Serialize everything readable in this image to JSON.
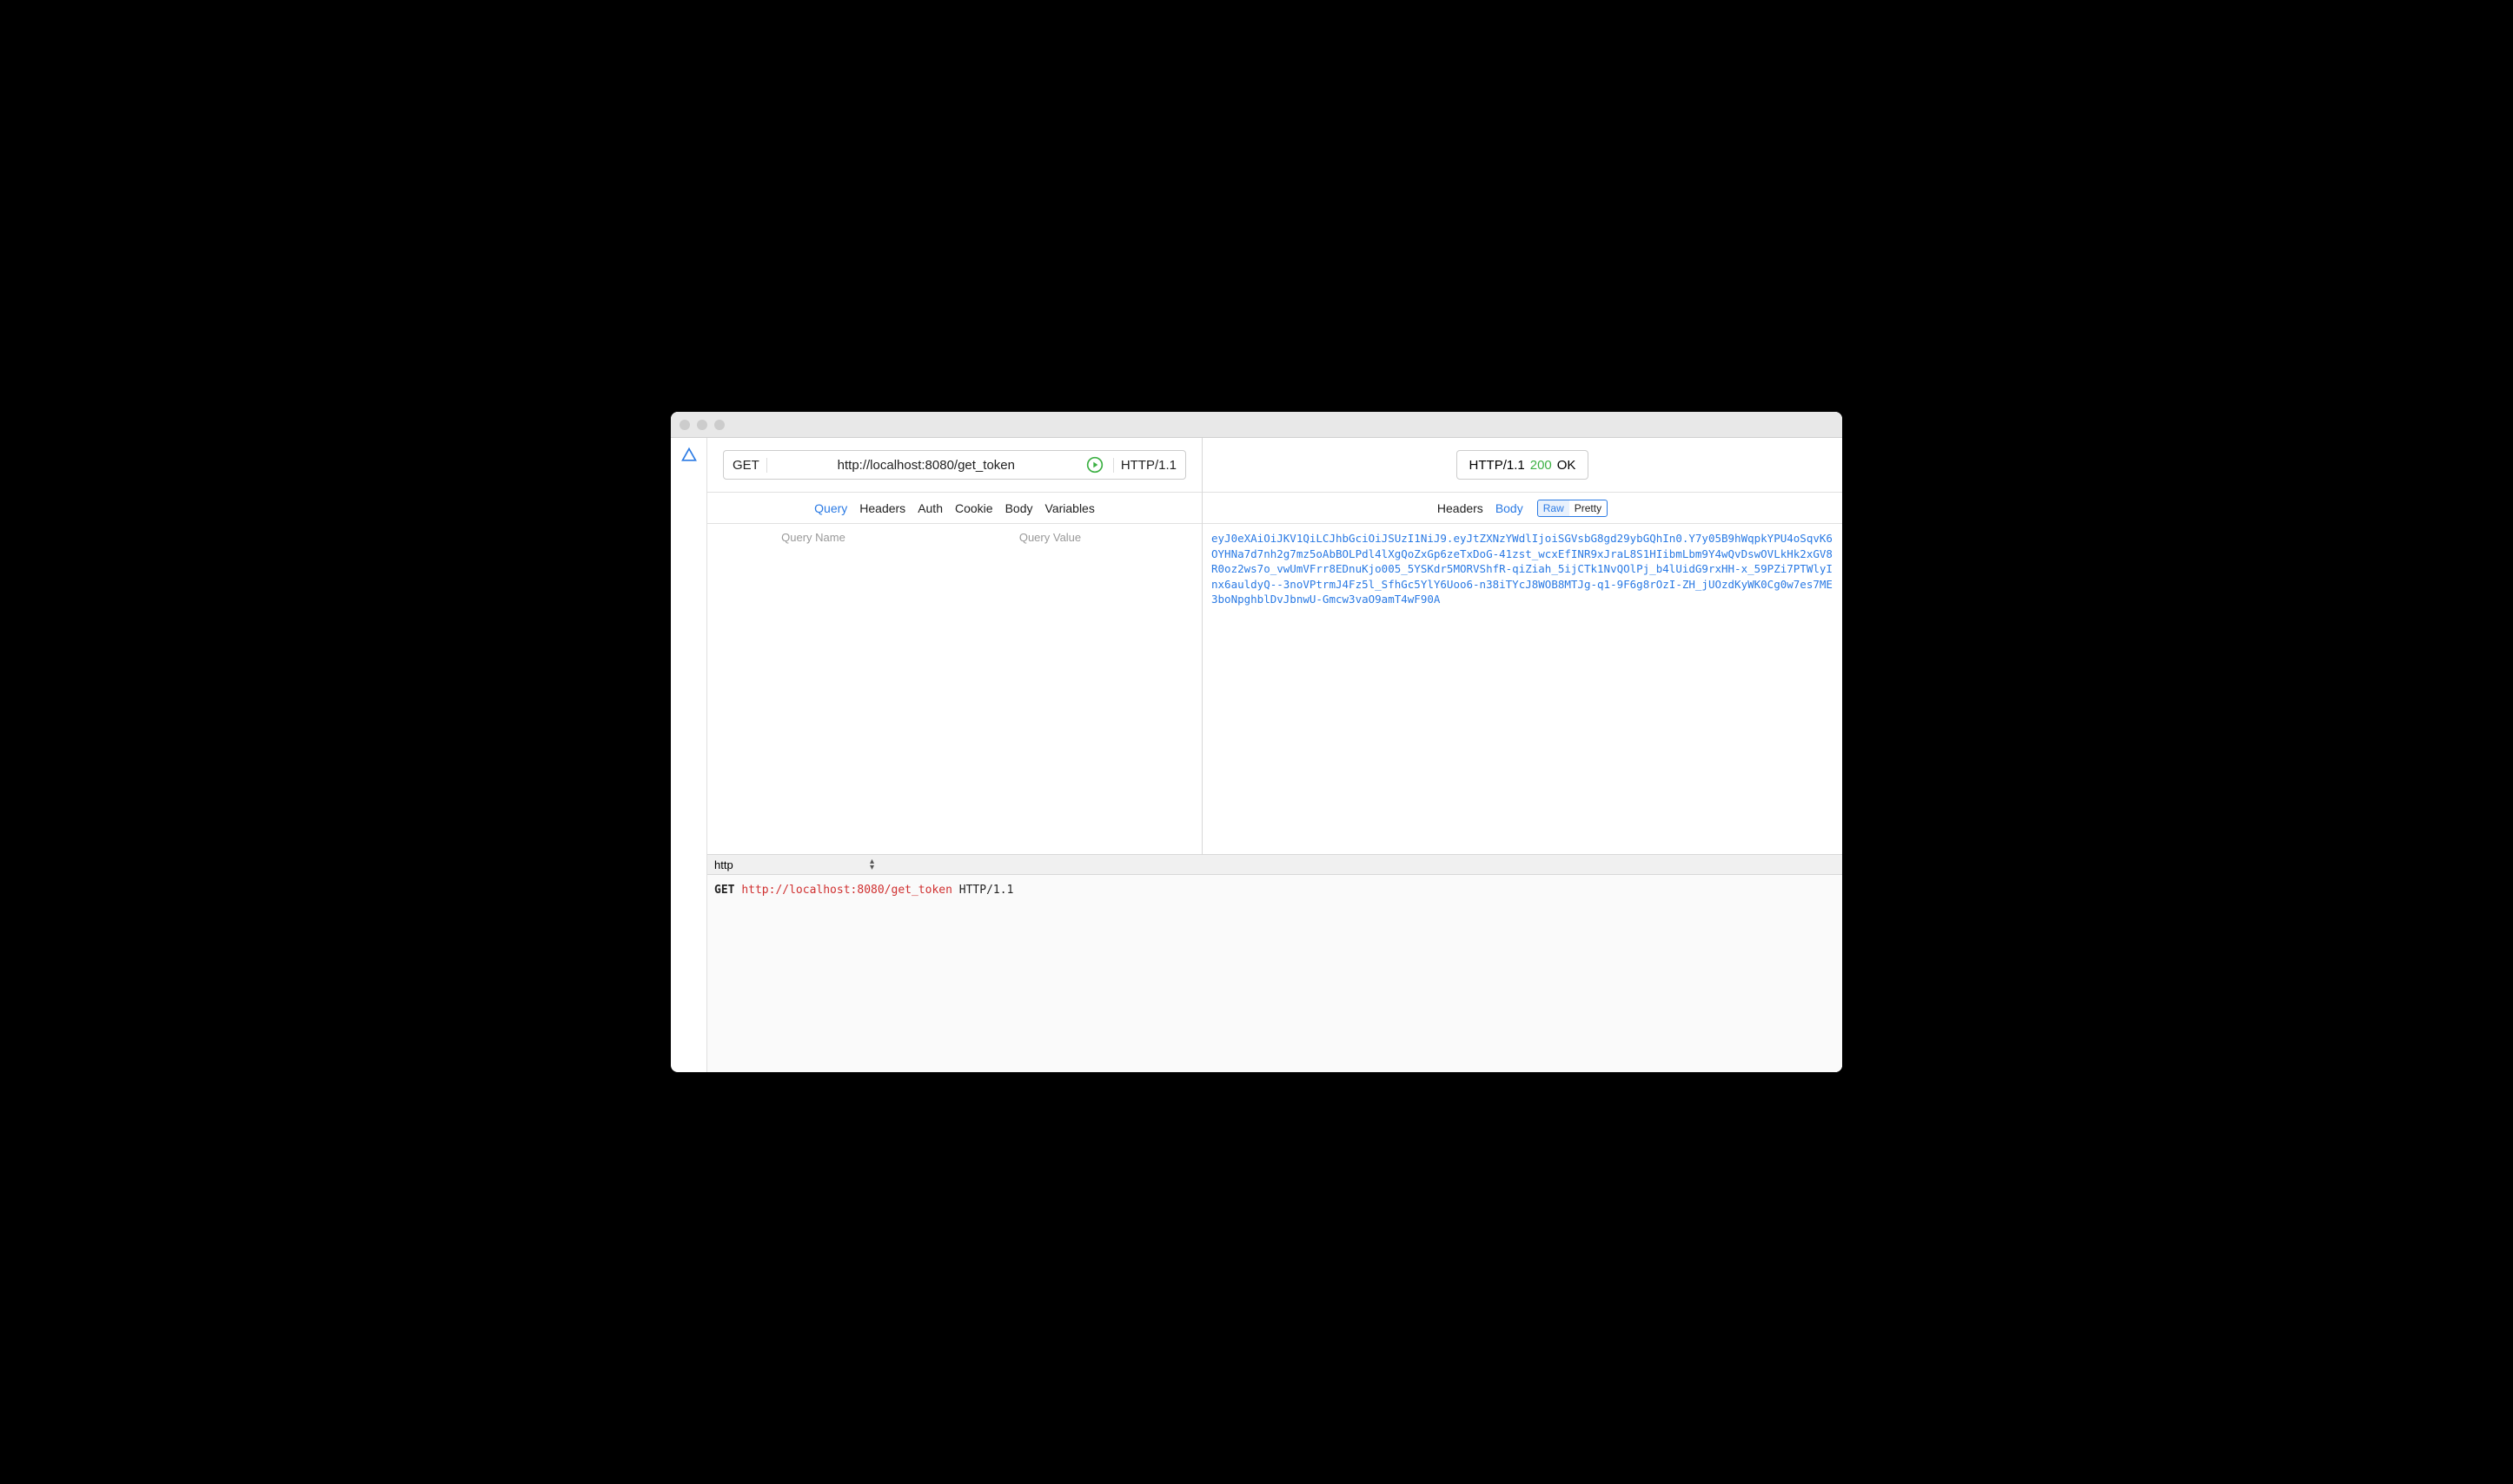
{
  "request": {
    "method": "GET",
    "url": "http://localhost:8080/get_token",
    "protocol": "HTTP/1.1"
  },
  "response": {
    "protocol": "HTTP/1.1",
    "status_code": "200",
    "status_text": "OK"
  },
  "request_tabs": [
    "Query",
    "Headers",
    "Auth",
    "Cookie",
    "Body",
    "Variables"
  ],
  "response_tabs": [
    "Headers",
    "Body"
  ],
  "view_modes": [
    "Raw",
    "Pretty"
  ],
  "query_columns": {
    "name": "Query Name",
    "value": "Query Value"
  },
  "response_body": "eyJ0eXAiOiJKV1QiLCJhbGciOiJSUzI1NiJ9.eyJtZXNzYWdlIjoiSGVsbG8gd29ybGQhIn0.Y7y05B9hWqpkYPU4oSqvK6OYHNa7d7nh2g7mz5oAbBOLPdl4lXgQoZxGp6zeTxDoG-41zst_wcxEfINR9xJraL8S1HIibmLbm9Y4wQvDswOVLkHk2xGV8R0oz2ws7o_vwUmVFrr8EDnuKjo005_5YSKdr5MORVShfR-qiZiah_5ijCTk1NvQOlPj_b4lUidG9rxHH-x_59PZi7PTWlyInx6auldyQ--3noVPtrmJ4Fz5l_SfhGc5YlY6Uoo6-n38iTYcJ8WOB8MTJg-q1-9F6g8rOzI-ZH_jUOzdKyWK0Cg0w7es7ME3boNpghblDvJbnwU-Gmcw3vaO9amT4wF90A",
  "raw_format": "http",
  "raw_request": {
    "method": "GET",
    "url": "http://localhost:8080/get_token",
    "protocol": "HTTP/1.1"
  }
}
